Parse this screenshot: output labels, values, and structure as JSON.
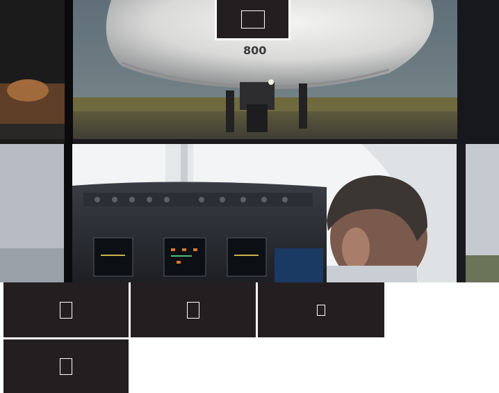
{
  "colors": {
    "tile_background": "#231f20",
    "icon_stroke": "#ffffff",
    "page_background": "#ffffff",
    "panel_divider": "#0a0a0c"
  },
  "hero_panels": [
    {
      "name": "airplane-nose-gear-image",
      "description_icon": "photo"
    },
    {
      "name": "cockpit-pilot-image",
      "description_icon": "photo"
    }
  ],
  "tiles": [
    {
      "name": "nav-tile-1",
      "icon": "square-outline-icon"
    },
    {
      "name": "nav-tile-2",
      "icon": "square-outline-icon"
    },
    {
      "name": "nav-tile-3",
      "icon": "square-outline-icon"
    },
    {
      "name": "nav-tile-4",
      "icon": "square-outline-icon"
    }
  ],
  "top_tile": {
    "icon": "square-outline-icon"
  }
}
